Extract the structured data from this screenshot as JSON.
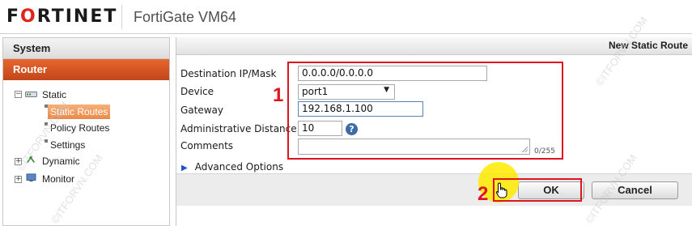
{
  "header": {
    "logo_part1": "F",
    "logo_red": "",
    "logo_text": "FORTINET",
    "app_title": "FortiGate VM64"
  },
  "sidebar": {
    "system_label": "System",
    "router_label": "Router",
    "tree": {
      "static": "Static",
      "static_routes": "Static Routes",
      "policy_routes": "Policy Routes",
      "settings": "Settings",
      "dynamic": "Dynamic",
      "monitor": "Monitor"
    }
  },
  "panel": {
    "title": "New Static Route"
  },
  "form": {
    "dest_label": "Destination IP/Mask",
    "dest_value": "0.0.0.0/0.0.0.0",
    "device_label": "Device",
    "device_value": "port1",
    "gateway_label": "Gateway",
    "gateway_value": "192.168.1.100",
    "distance_label": "Administrative Distance",
    "distance_value": "10",
    "comments_label": "Comments",
    "comments_counter": "0/255",
    "advanced_label": "Advanced Options"
  },
  "buttons": {
    "ok": "OK",
    "cancel": "Cancel"
  },
  "annotations": {
    "step1": "1",
    "step2": "2"
  },
  "watermarks": {
    "text1": "©ITFORVN.COM",
    "text2": "©ITFORVN.COM",
    "text3": "©ITFORVN.COM",
    "text4": "©ITFORVN.COM"
  },
  "colors": {
    "brand_red": "#e2231a",
    "router_orange": "#d4541f",
    "annotation_red": "#e0141e",
    "help_blue": "#3d6aa8"
  }
}
